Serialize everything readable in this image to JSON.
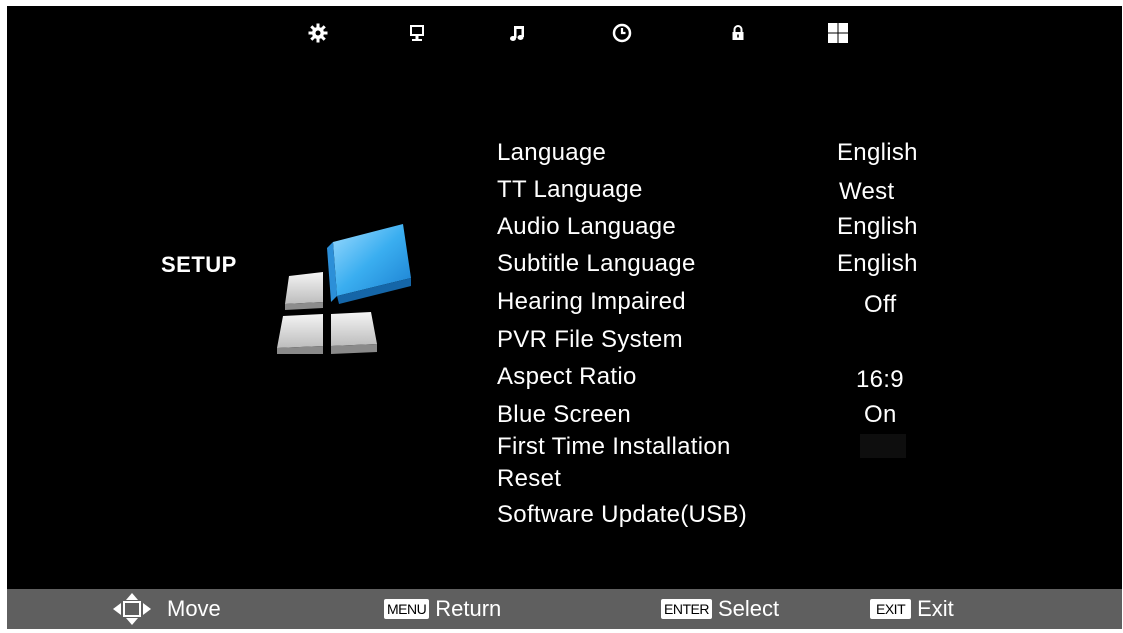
{
  "topbar": {
    "icons": [
      {
        "name": "gear-icon"
      },
      {
        "name": "monitor-icon"
      },
      {
        "name": "music-note-icon"
      },
      {
        "name": "clock-icon"
      },
      {
        "name": "lock-icon"
      },
      {
        "name": "grid-icon"
      }
    ]
  },
  "section": {
    "title": "SETUP",
    "icon": "setup-blocks-graphic",
    "accent_color": "#2aa7e8"
  },
  "menu": {
    "items": [
      {
        "label": "Language",
        "value": "English"
      },
      {
        "label": "TT Language",
        "value": "West"
      },
      {
        "label": "Audio Language",
        "value": "English"
      },
      {
        "label": "Subtitle Language",
        "value": "English"
      },
      {
        "label": "Hearing Impaired",
        "value": "Off"
      },
      {
        "label": "PVR File System",
        "value": ""
      },
      {
        "label": "Aspect Ratio",
        "value": "16:9"
      },
      {
        "label": "Blue Screen",
        "value": "On"
      },
      {
        "label": "First Time Installation",
        "value": ""
      },
      {
        "label": "Reset",
        "value": ""
      },
      {
        "label": "Software Update(USB)",
        "value": ""
      }
    ]
  },
  "bottombar": {
    "move": {
      "icon": "dpad-icon",
      "label": "Move"
    },
    "return": {
      "key": "MENU",
      "label": "Return"
    },
    "select": {
      "key": "ENTER",
      "label": "Select"
    },
    "exit": {
      "key": "EXIT",
      "label": "Exit"
    }
  }
}
